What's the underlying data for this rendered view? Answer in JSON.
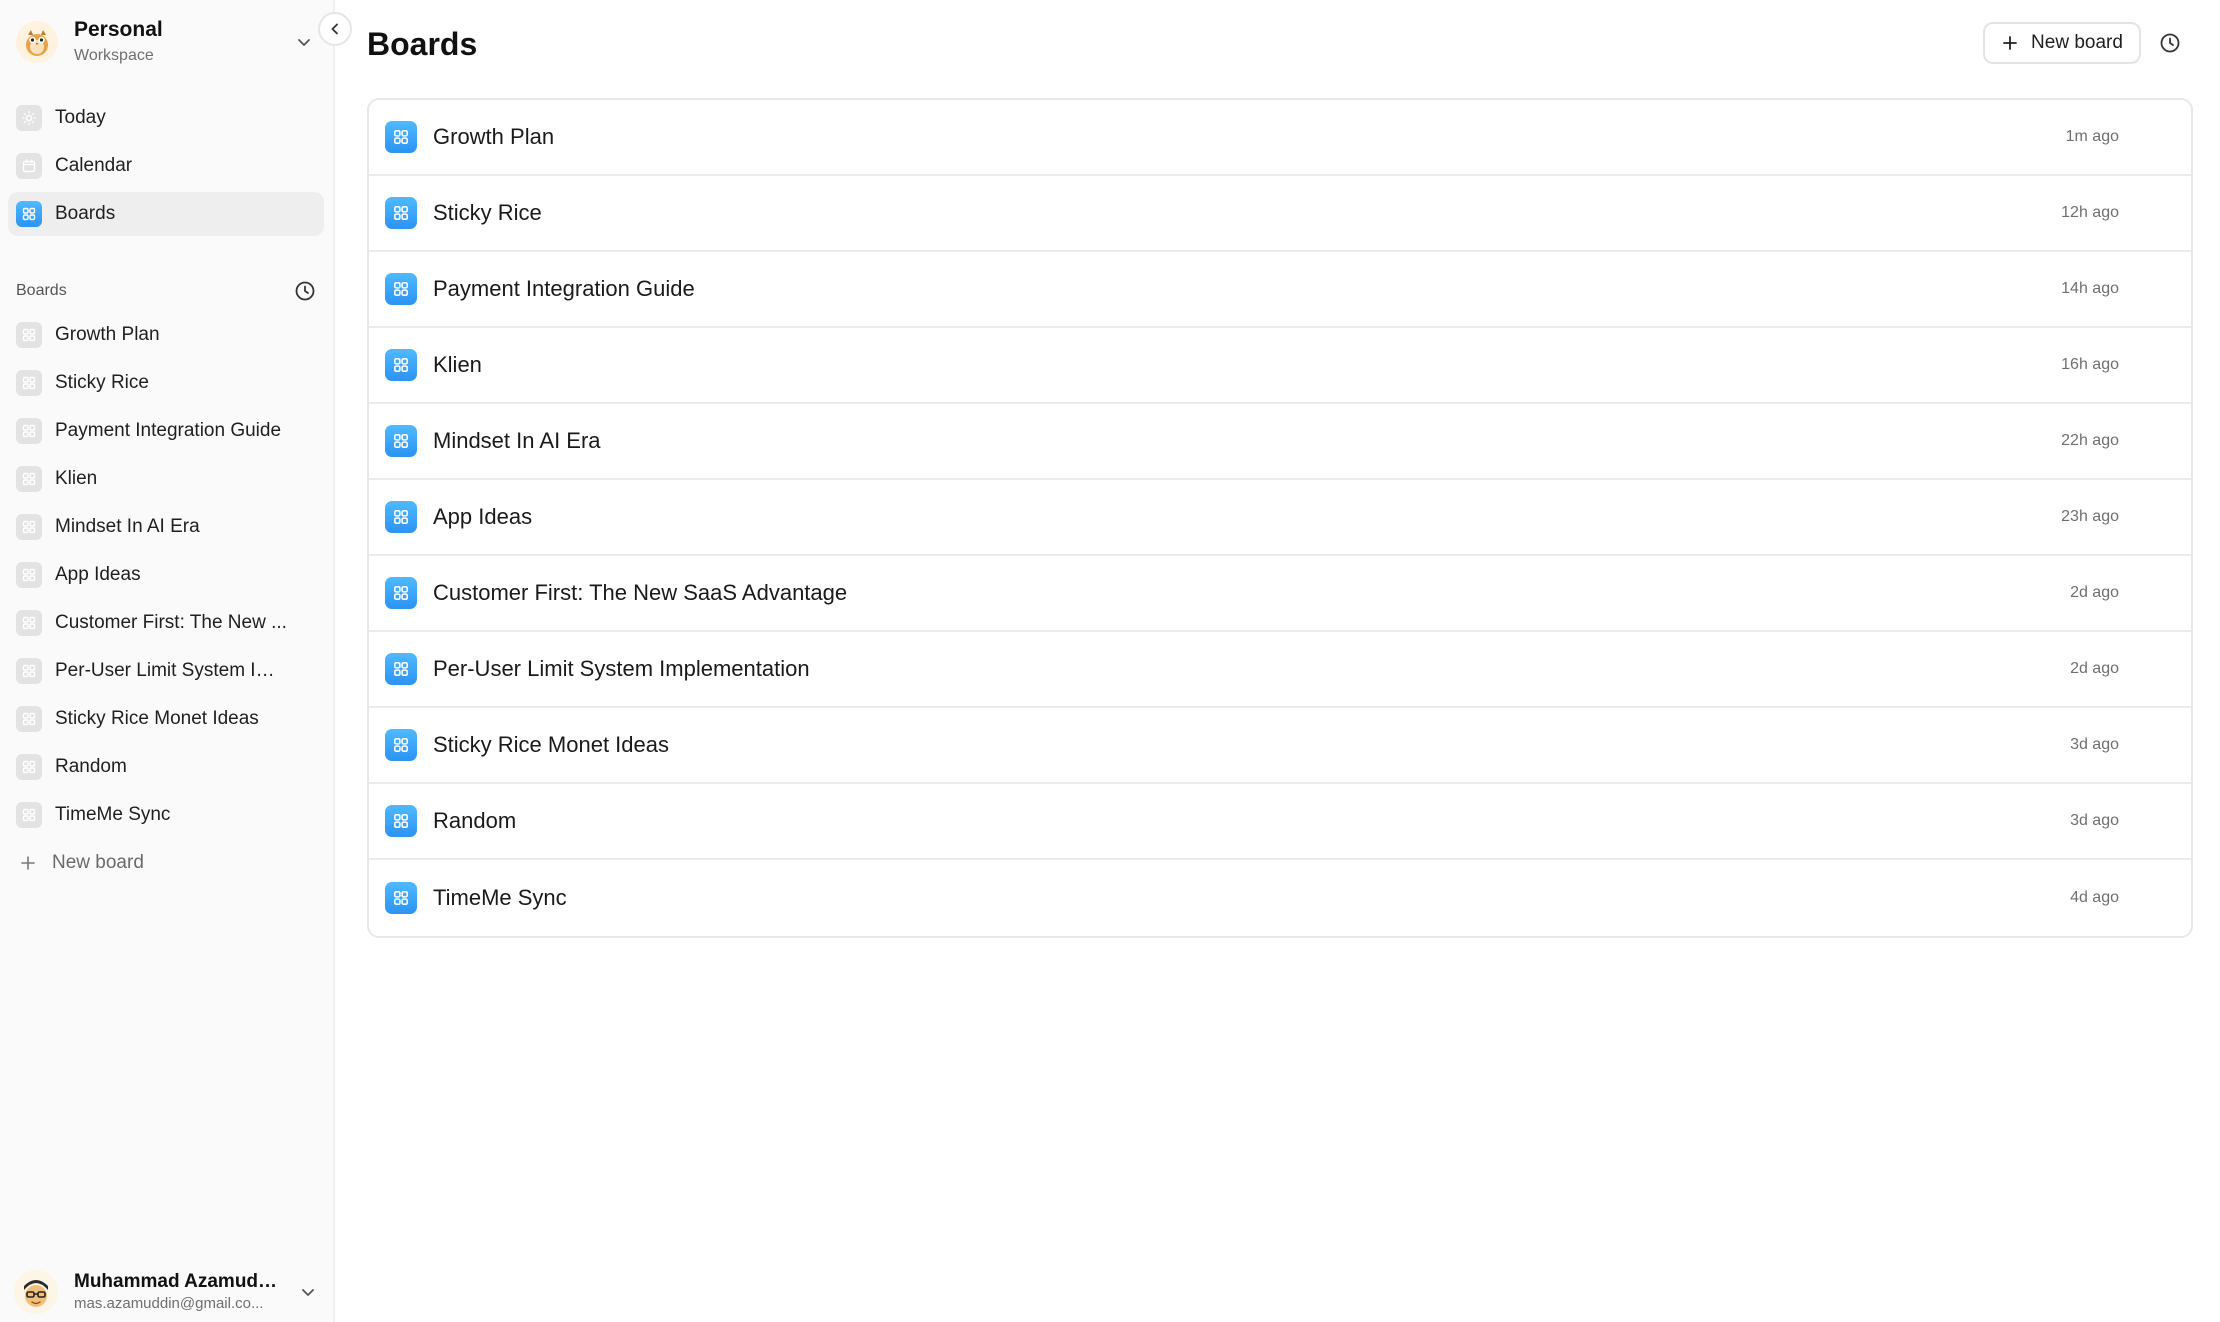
{
  "workspace": {
    "name": "Personal",
    "subtitle": "Workspace"
  },
  "nav": [
    {
      "label": "Today",
      "icon": "sun-icon"
    },
    {
      "label": "Calendar",
      "icon": "calendar-icon"
    },
    {
      "label": "Boards",
      "icon": "board-grid-icon",
      "active": true
    }
  ],
  "sidebar_boards": {
    "title": "Boards",
    "items": [
      {
        "label": "Growth Plan"
      },
      {
        "label": "Sticky Rice"
      },
      {
        "label": "Payment Integration Guide"
      },
      {
        "label": "Klien"
      },
      {
        "label": "Mindset In AI Era"
      },
      {
        "label": "App Ideas"
      },
      {
        "label": "Customer First: The New ..."
      },
      {
        "label": "Per-User Limit System Im..."
      },
      {
        "label": "Sticky Rice Monet Ideas"
      },
      {
        "label": "Random"
      },
      {
        "label": "TimeMe Sync"
      }
    ],
    "new_label": "New board"
  },
  "user": {
    "name": "Muhammad Azamudd...",
    "email": "mas.azamuddin@gmail.co..."
  },
  "main": {
    "title": "Boards",
    "new_button": "New board",
    "boards": [
      {
        "title": "Growth Plan",
        "time": "1m ago"
      },
      {
        "title": "Sticky Rice",
        "time": "12h ago"
      },
      {
        "title": "Payment Integration Guide",
        "time": "14h ago"
      },
      {
        "title": "Klien",
        "time": "16h ago"
      },
      {
        "title": "Mindset In AI Era",
        "time": "22h ago"
      },
      {
        "title": "App Ideas",
        "time": "23h ago"
      },
      {
        "title": "Customer First: The New SaaS Advantage",
        "time": "2d ago"
      },
      {
        "title": "Per-User Limit System Implementation",
        "time": "2d ago"
      },
      {
        "title": "Sticky Rice Monet Ideas",
        "time": "3d ago"
      },
      {
        "title": "Random",
        "time": "3d ago"
      },
      {
        "title": "TimeMe Sync",
        "time": "4d ago"
      }
    ]
  },
  "colors": {
    "accent_blue": "#2b93f2",
    "sidebar_bg": "#fafafa",
    "active_bg": "#eeeeee",
    "muted_text": "#6f6f6f"
  }
}
